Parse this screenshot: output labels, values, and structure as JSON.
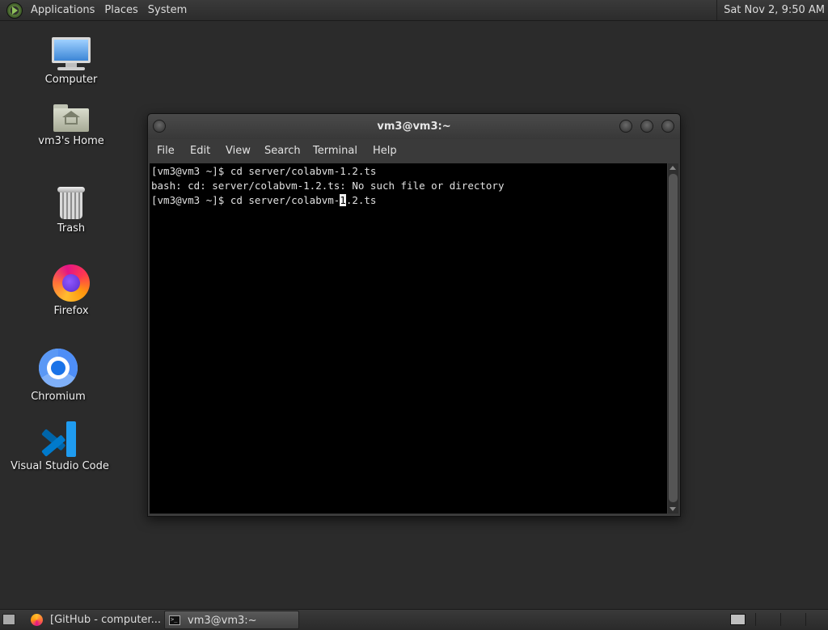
{
  "top_panel": {
    "menus": [
      "Applications",
      "Places",
      "System"
    ],
    "clock": "Sat Nov  2,  9:50 AM"
  },
  "desktop_icons": [
    {
      "label": "Computer",
      "icon": "computer-icon"
    },
    {
      "label": "vm3's Home",
      "icon": "home-folder-icon"
    },
    {
      "label": "Trash",
      "icon": "trash-icon"
    },
    {
      "label": "Firefox",
      "icon": "firefox-icon"
    },
    {
      "label": "Chromium",
      "icon": "chromium-icon"
    },
    {
      "label": "Visual Studio Code",
      "icon": "vscode-icon"
    }
  ],
  "terminal": {
    "title": "vm3@vm3:~",
    "menus": [
      "File",
      "Edit",
      "View",
      "Search",
      "Terminal",
      "Help"
    ],
    "lines": [
      "[vm3@vm3 ~]$ cd server/colabvm-1.2.ts",
      "bash: cd: server/colabvm-1.2.ts: No such file or directory"
    ],
    "current_line": {
      "before_cursor": "[vm3@vm3 ~]$ cd server/colabvm-",
      "cursor_char": "1",
      "after_cursor": ".2.ts"
    }
  },
  "taskbar": {
    "tasks": [
      {
        "label": "[GitHub - computer...",
        "icon": "firefox-icon",
        "active": false
      },
      {
        "label": "vm3@vm3:~",
        "icon": "terminal-icon",
        "active": true
      }
    ]
  }
}
